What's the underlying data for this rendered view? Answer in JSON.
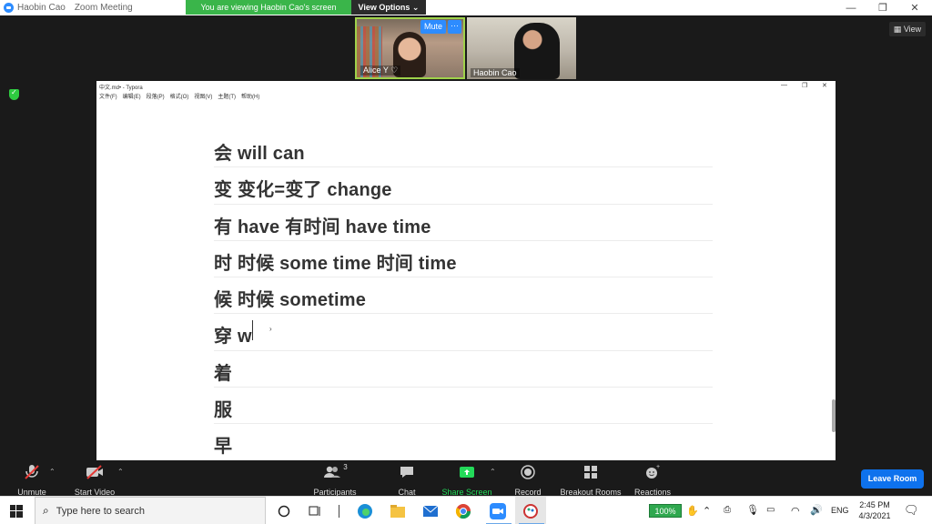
{
  "titlebar": {
    "user_name": "Haobin Cao",
    "app_name": "Zoom Meeting"
  },
  "banner": {
    "viewing_text": "You are viewing Haobin Cao's screen",
    "view_options": "View Options ⌄"
  },
  "participants_video": [
    {
      "name": "Alice Y ♡"
    },
    {
      "name": "Haobin Cao"
    }
  ],
  "video_controls": {
    "mute": "Mute",
    "more": "···"
  },
  "view_label": "View",
  "typora": {
    "title": "中文.md• - Typora",
    "menu": [
      "文件(F)",
      "编辑(E)",
      "段落(P)",
      "格式(O)",
      "视图(V)",
      "主题(T)",
      "帮助(H)"
    ],
    "lines": [
      "会 will can",
      "变 变化=变了 change",
      "有 have 有时间 have time",
      "时 时候 some time 时间 time",
      "候 时候 sometime",
      "穿 w",
      "着",
      "服",
      "早"
    ]
  },
  "toolbar": {
    "unmute": "Unmute",
    "start_video": "Start Video",
    "participants": "Participants",
    "participants_count": "3",
    "chat": "Chat",
    "share_screen": "Share Screen",
    "record": "Record",
    "breakout_rooms": "Breakout Rooms",
    "reactions": "Reactions",
    "leave_room": "Leave Room"
  },
  "taskbar": {
    "search_placeholder": "Type here to search",
    "battery": "100%",
    "language": "ENG",
    "time": "2:45 PM",
    "date": "4/3/2021"
  },
  "colors": {
    "zoom_blue": "#2d8cff",
    "green_banner": "#3ab54a",
    "share_green": "#23d959"
  }
}
